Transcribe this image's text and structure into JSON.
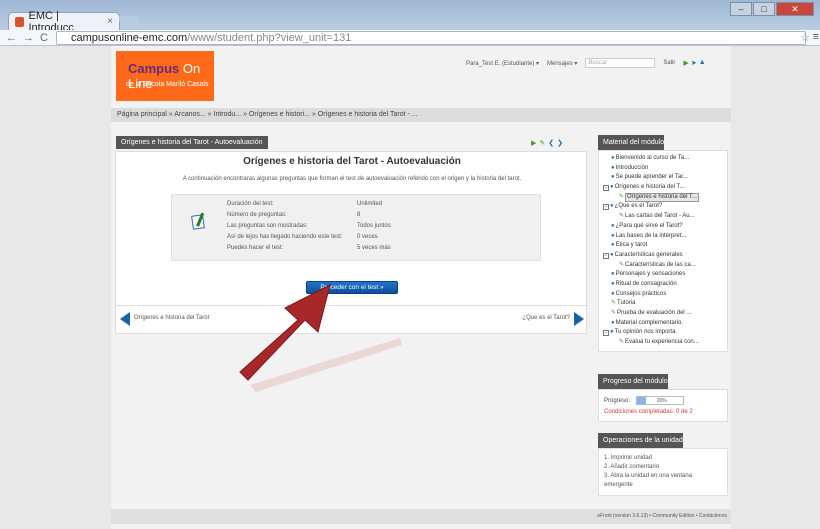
{
  "browser": {
    "tab_title": "EMC | Introducc",
    "tab_close": "×",
    "url_host": "campusonline-emc.com",
    "url_path": "/www/student.php?view_unit=131",
    "window_buttons": [
      "–",
      "□",
      "✕"
    ]
  },
  "header": {
    "logo_line1_a": "Campus",
    "logo_line1_b": "On Line",
    "logo_line2": "de la Escola Mariló Casals",
    "user": "Para_Test E. (Estudiante) ▾",
    "messages": "Mensajes ▾",
    "search_placeholder": "Buscar",
    "logout": "Salir"
  },
  "breadcrumb": "Página principal  »  Arcanos...  »  Introdu...  »  Orígenes e histori...  »  Orígenes e historia del Tarot - ...",
  "main": {
    "panel_title": "Orígenes e historia del Tarot - Autoevaluación",
    "title": "Orígenes e historia del Tarot - Autoevaluación",
    "intro": "A continuación encontraras algunas preguntas que forman el test de autoevaluación referido con el origen y la historia del tarot.",
    "info": [
      {
        "label": "Duración del test:",
        "value": "Unlimited"
      },
      {
        "label": "Número de preguntas:",
        "value": "8"
      },
      {
        "label": "Las preguntas son mostradas:",
        "value": "Todos juntos"
      },
      {
        "label": "Así de lejos has llegado haciendo este test:",
        "value": "0 veces"
      },
      {
        "label": "Puedes hacer el test:",
        "value": "5 veces más"
      }
    ],
    "proceed_button": "Proceder con el test »",
    "prev_label": "Orígenes e historia del Tarot",
    "next_label": "¿Que es el Tarot?"
  },
  "sidebar": {
    "material_title": "Material del módulo",
    "tree": [
      {
        "label": "Bienvenido al curso de Ta...",
        "indent": 1,
        "icon": "bullet"
      },
      {
        "label": "Introducción",
        "indent": 1,
        "icon": "bullet"
      },
      {
        "label": "Se puede aprender el Tar...",
        "indent": 1,
        "icon": "bullet"
      },
      {
        "label": "Orígenes e historia del T...",
        "indent": 0,
        "icon": "box"
      },
      {
        "label": "Orígenes e historia del T...",
        "indent": 2,
        "icon": "pen",
        "selected": true
      },
      {
        "label": "¿Que es el Tarot?",
        "indent": 0,
        "icon": "box"
      },
      {
        "label": "Las cartas del Tarot - Au...",
        "indent": 2,
        "icon": "pen"
      },
      {
        "label": "¿Para qué sirve el Tarot?",
        "indent": 1,
        "icon": "bullet"
      },
      {
        "label": "Las bases de la interpret...",
        "indent": 1,
        "icon": "bullet"
      },
      {
        "label": "Ética y tarot",
        "indent": 1,
        "icon": "bullet"
      },
      {
        "label": "Características generales",
        "indent": 0,
        "icon": "box"
      },
      {
        "label": "Características de las ca...",
        "indent": 2,
        "icon": "pen"
      },
      {
        "label": "Personajes y sensaciones",
        "indent": 1,
        "icon": "bullet"
      },
      {
        "label": "Ritual de consagración",
        "indent": 1,
        "icon": "bullet"
      },
      {
        "label": "Consejos prácticos",
        "indent": 1,
        "icon": "bullet"
      },
      {
        "label": "Tutoria",
        "indent": 1,
        "icon": "pen"
      },
      {
        "label": "Prueba de evaluación del ...",
        "indent": 1,
        "icon": "pen"
      },
      {
        "label": "Material complementario.",
        "indent": 1,
        "icon": "bullet"
      },
      {
        "label": "Tu opinión nos importa.",
        "indent": 0,
        "icon": "box"
      },
      {
        "label": "Evalua tu experiencia con...",
        "indent": 2,
        "icon": "pen"
      }
    ],
    "progress_title": "Progreso del módulo",
    "progress_label": "Progreso:",
    "progress_value": "20%",
    "progress_fraction": 0.2,
    "conditions": "Condiciones completadas: 0 de 2",
    "ops_title": "Operaciones de la unidad",
    "ops": [
      "1. Imprimir unidad",
      "2. Añadir comentario",
      "3. Abra la unidad en una ventana emergente"
    ]
  },
  "footer": "eFront (version 3.6.13) • Community Edition • Contáctenos",
  "colors": {
    "brand_orange": "#ff6a1a",
    "primary_blue": "#0c4f9a",
    "arrow_red": "#a8282a",
    "alert_red": "#d2383a"
  }
}
